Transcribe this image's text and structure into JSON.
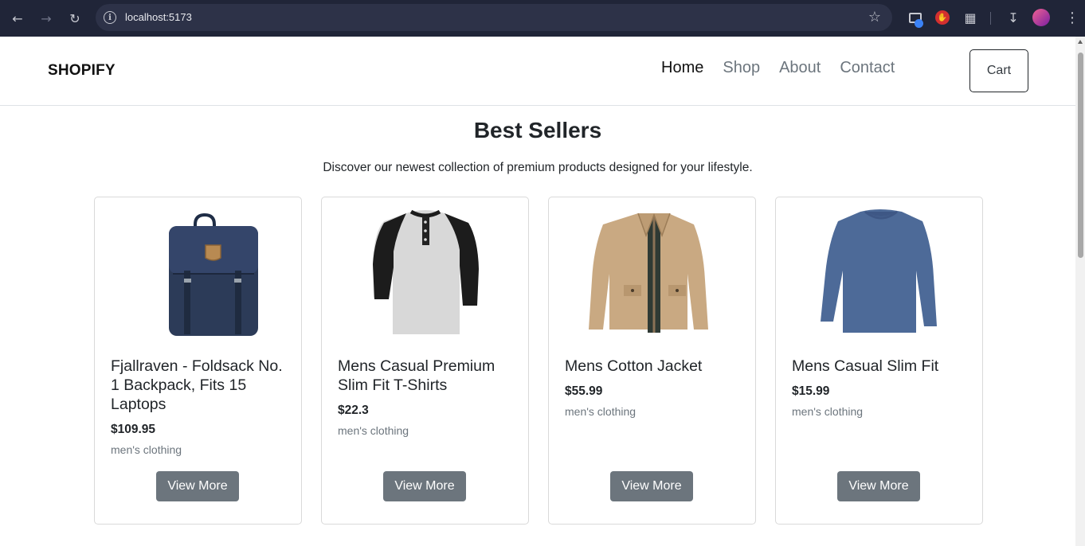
{
  "browser": {
    "url": "localhost:5173"
  },
  "site": {
    "logo": "SHOPIFY",
    "nav": [
      "Home",
      "Shop",
      "About",
      "Contact"
    ],
    "active_nav": "Home",
    "cart_label": "Cart"
  },
  "section": {
    "title": "Best Sellers",
    "subtitle": "Discover our newest collection of premium products designed for your lifestyle."
  },
  "products": [
    {
      "title": "Fjallraven - Foldsack No. 1 Backpack, Fits 15 Laptops",
      "price": "$109.95",
      "category": "men's clothing",
      "button": "View More",
      "image_icon": "backpack-image"
    },
    {
      "title": "Mens Casual Premium Slim Fit T-Shirts",
      "price": "$22.3",
      "category": "men's clothing",
      "button": "View More",
      "image_icon": "tshirt-image"
    },
    {
      "title": "Mens Cotton Jacket",
      "price": "$55.99",
      "category": "men's clothing",
      "button": "View More",
      "image_icon": "jacket-image"
    },
    {
      "title": "Mens Casual Slim Fit",
      "price": "$15.99",
      "category": "men's clothing",
      "button": "View More",
      "image_icon": "longsleeve-image"
    }
  ],
  "colors": {
    "chrome_bg": "#202538",
    "button_bg": "#6c757d",
    "muted_text": "#6c757d"
  }
}
